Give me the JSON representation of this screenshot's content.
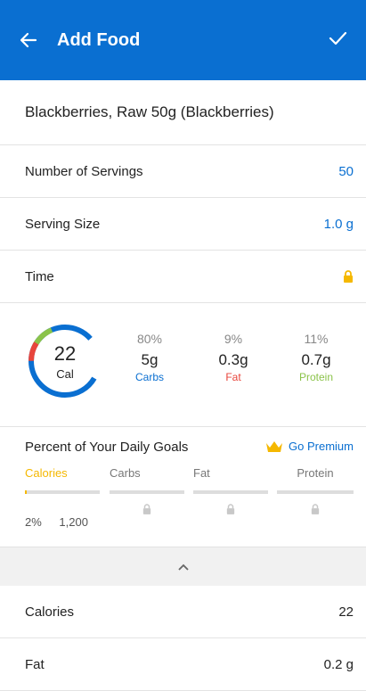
{
  "header": {
    "title": "Add Food"
  },
  "food": {
    "name": "Blackberries, Raw 50g (Blackberries)"
  },
  "rows": {
    "servings_label": "Number of Servings",
    "servings_value": "50",
    "size_label": "Serving Size",
    "size_value": "1.0 g",
    "time_label": "Time"
  },
  "summary": {
    "calories": "22",
    "cal_unit": "Cal",
    "carbs": {
      "pct": "80%",
      "amount": "5g",
      "label": "Carbs"
    },
    "fat": {
      "pct": "9%",
      "amount": "0.3g",
      "label": "Fat"
    },
    "protein": {
      "pct": "11%",
      "amount": "0.7g",
      "label": "Protein"
    }
  },
  "goals": {
    "title": "Percent of Your Daily Goals",
    "premium": "Go Premium",
    "columns": [
      "Calories",
      "Carbs",
      "Fat",
      "Protein"
    ],
    "calories_pct": "2%",
    "calories_goal": "1,200",
    "calories_fill": 0.02
  },
  "nutrients": [
    {
      "label": "Calories",
      "value": "22"
    },
    {
      "label": "Fat",
      "value": "0.2 g"
    }
  ],
  "colors": {
    "primary": "#0a6fd1",
    "carbs": "#0a6fd1",
    "fat": "#e8453c",
    "protein": "#8bc34a",
    "gold": "#f5b800"
  }
}
